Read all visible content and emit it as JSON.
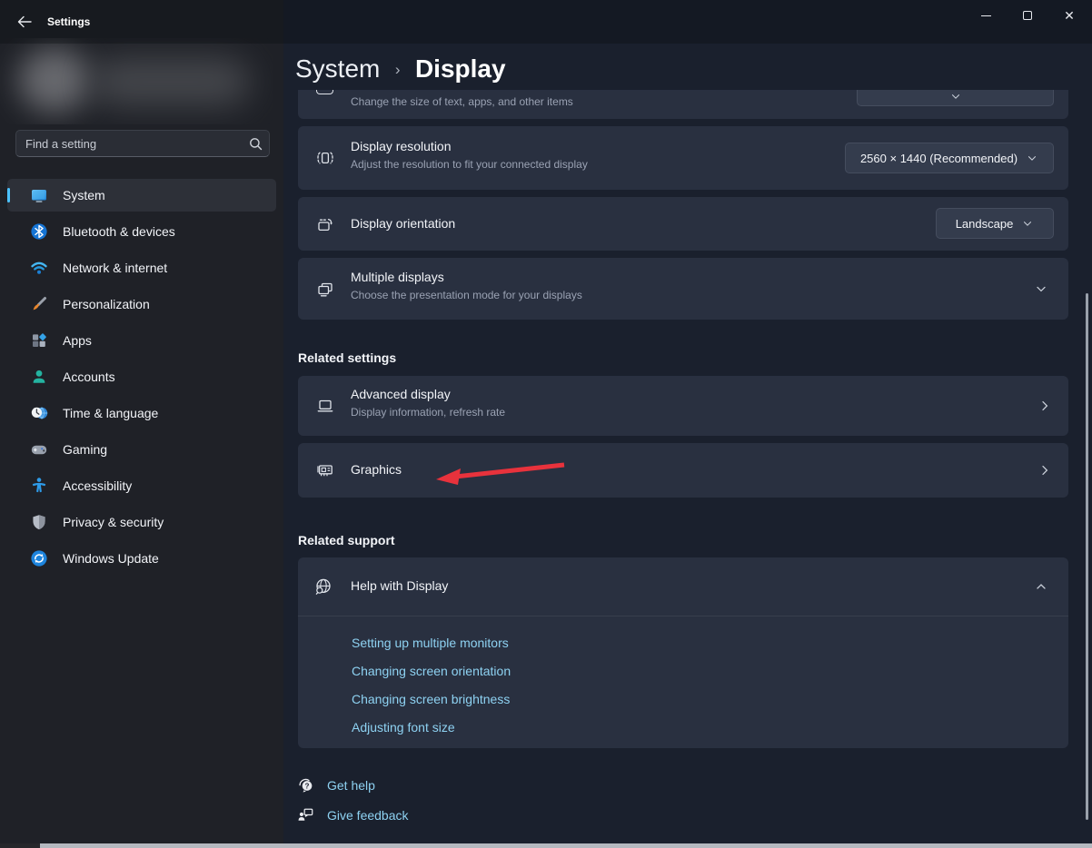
{
  "window": {
    "title": "Settings"
  },
  "sidebar": {
    "search": {
      "placeholder": "Find a setting"
    },
    "items": [
      {
        "label": "System",
        "selected": true
      },
      {
        "label": "Bluetooth & devices",
        "selected": false
      },
      {
        "label": "Network & internet",
        "selected": false
      },
      {
        "label": "Personalization",
        "selected": false
      },
      {
        "label": "Apps",
        "selected": false
      },
      {
        "label": "Accounts",
        "selected": false
      },
      {
        "label": "Time & language",
        "selected": false
      },
      {
        "label": "Gaming",
        "selected": false
      },
      {
        "label": "Accessibility",
        "selected": false
      },
      {
        "label": "Privacy & security",
        "selected": false
      },
      {
        "label": "Windows Update",
        "selected": false
      }
    ]
  },
  "breadcrumb": {
    "parent": "System",
    "separator": "›",
    "current": "Display"
  },
  "content": {
    "scale_row": {
      "subtitle": "Change the size of text, apps, and other items"
    },
    "resolution_row": {
      "title": "Display resolution",
      "subtitle": "Adjust the resolution to fit your connected display",
      "value": "2560 × 1440 (Recommended)"
    },
    "orientation_row": {
      "title": "Display orientation",
      "value": "Landscape"
    },
    "multiple_displays_row": {
      "title": "Multiple displays",
      "subtitle": "Choose the presentation mode for your displays"
    },
    "related_settings": {
      "header": "Related settings",
      "advanced_display": {
        "title": "Advanced display",
        "subtitle": "Display information, refresh rate"
      },
      "graphics": {
        "title": "Graphics"
      }
    },
    "related_support": {
      "header": "Related support",
      "help_row": {
        "title": "Help with Display"
      },
      "links": [
        "Setting up multiple monitors",
        "Changing screen orientation",
        "Changing screen brightness",
        "Adjusting font size"
      ]
    },
    "footer_links": {
      "get_help": "Get help",
      "give_feedback": "Give feedback"
    }
  },
  "colors": {
    "accent": "#4cc2ff",
    "link": "#8ed2f2",
    "annotation_arrow": "#e8323c"
  }
}
